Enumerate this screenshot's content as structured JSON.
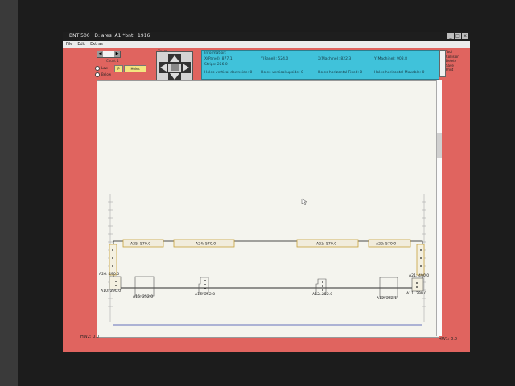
{
  "window": {
    "title": "BNT 500 · D: ares· A1 *bnt · 1916",
    "buttons": [
      "_",
      "□",
      "x"
    ]
  },
  "menu": [
    "File",
    "Edit",
    "Extras"
  ],
  "controls": {
    "caption": "Count 1",
    "radio_1": "Low",
    "radio_2": "Below",
    "button_small": "P",
    "button_main": "Holes"
  },
  "nav": {
    "caption": "Zoom"
  },
  "info": {
    "title": "Information:",
    "row1": [
      "X(Panel): 877.1",
      "Y(Panel): 524.0",
      "X(Machine): 822.3",
      "Y(Machine): 908.8"
    ],
    "row2": "Strips: 256.0",
    "row3": [
      "Holes vertical downside: 0",
      "Holes vertical upside: 0",
      "Holes horizontal Fixed: 0",
      "Holes horizontal Movable: 0"
    ]
  },
  "side_menu": [
    "Tool",
    "Collision",
    "Delete",
    "Save",
    "Print"
  ],
  "drawing": {
    "top_labels": [
      "A25: 570.0",
      "A24: 570.0",
      "A23: 570.0",
      "A22: 570.0"
    ],
    "left_label_top": "A26: 490.0",
    "left_label_bottom": "A10: 290.0",
    "right_label_top": "A21: 490.0",
    "right_label_bottom": "A11: 290.0",
    "bottom_labels": [
      "A15: 252.0",
      "A16: 252.0",
      "A13: 252.0",
      "A12: 262.1"
    ]
  },
  "status": {
    "left": "HW2: 0.0",
    "right": "HW1: 0.0"
  }
}
